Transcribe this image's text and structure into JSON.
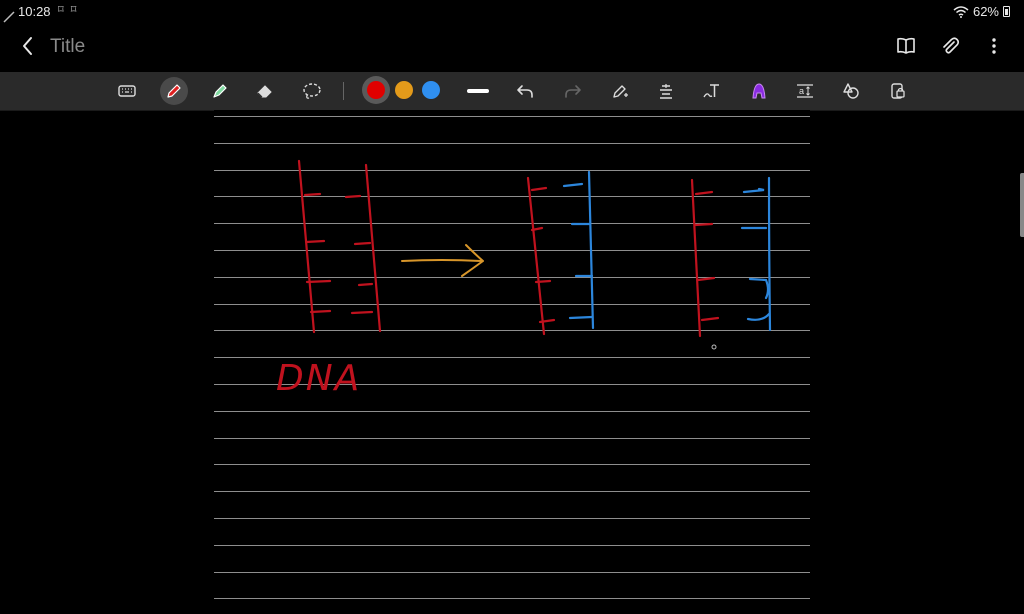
{
  "status_bar": {
    "time": "10:28",
    "notifications": "⌑ ⌑",
    "battery": "62%"
  },
  "header": {
    "title": "Title"
  },
  "toolbar": {
    "colors": [
      "#e00000",
      "#e39a1a",
      "#2f8ff0"
    ],
    "selected_color": "#e00000"
  },
  "canvas": {
    "handwritten_label": "DNA",
    "ink_colors": {
      "red": "#c0121e",
      "blue": "#2c86dc",
      "orange": "#d8962a"
    }
  }
}
